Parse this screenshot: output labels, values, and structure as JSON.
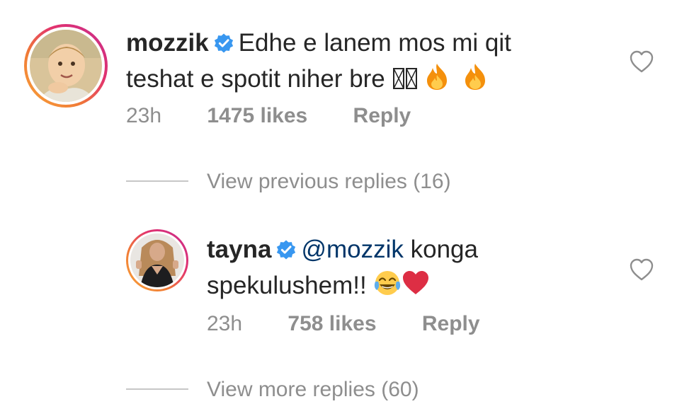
{
  "comments": [
    {
      "username": "mozzik",
      "verified": true,
      "text_line1": "Edhe e lanem mos mi qit",
      "text_line2": "teshat e spotit niher bre",
      "emojis": [
        "unknown-glyph",
        "unknown-glyph",
        "fire",
        "fire"
      ],
      "time": "23h",
      "likes": "1475 likes",
      "reply_label": "Reply"
    },
    {
      "username": "tayna",
      "verified": true,
      "mention": "@mozzik",
      "text_line1": "konga",
      "text_line2": "spekulushem!!",
      "emojis": [
        "face-with-tears-of-joy",
        "red-heart"
      ],
      "time": "23h",
      "likes": "758 likes",
      "reply_label": "Reply"
    }
  ],
  "thread": {
    "view_previous": "View previous replies (16)",
    "view_more": "View more replies (60)"
  },
  "icons": {
    "verified_color": "#3897f0",
    "like_icon": "heart-outline-icon"
  }
}
